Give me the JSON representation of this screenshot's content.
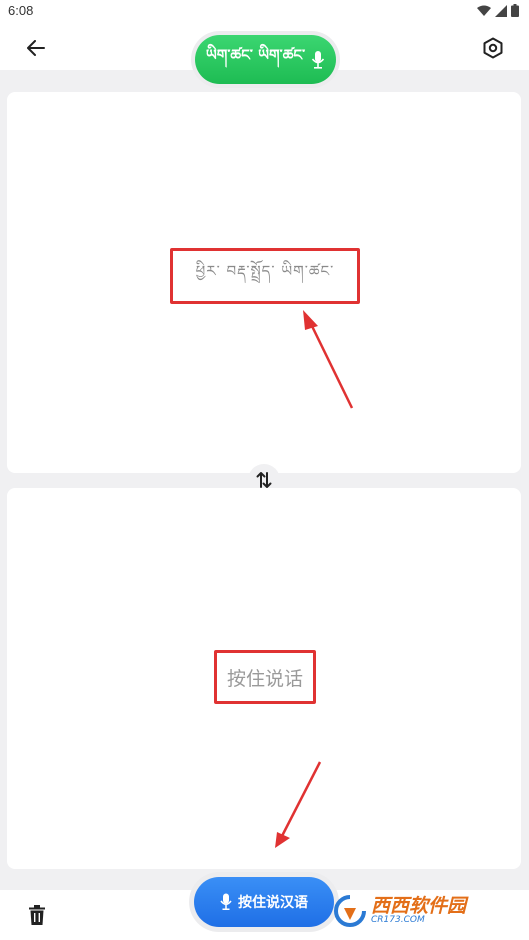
{
  "status_bar": {
    "time": "6:08"
  },
  "header": {
    "source_language": "ཡིག་ཚང་ ཡིག་ཚང་"
  },
  "top_panel": {
    "result_text": "ཕྱིར་ བརྡ་སྤྲོད་ ཡིག་ཚང་"
  },
  "bottom_panel": {
    "hint_text": "按住说话"
  },
  "footer": {
    "speak_button_label": "按住说汉语"
  },
  "watermark": {
    "brand_cn": "西西软件园",
    "brand_url": "CR173.COM"
  },
  "colors": {
    "accent_green": "#23c25a",
    "accent_blue": "#2a7ef0",
    "highlight_red": "#e03232",
    "background": "#f0f0f2"
  }
}
